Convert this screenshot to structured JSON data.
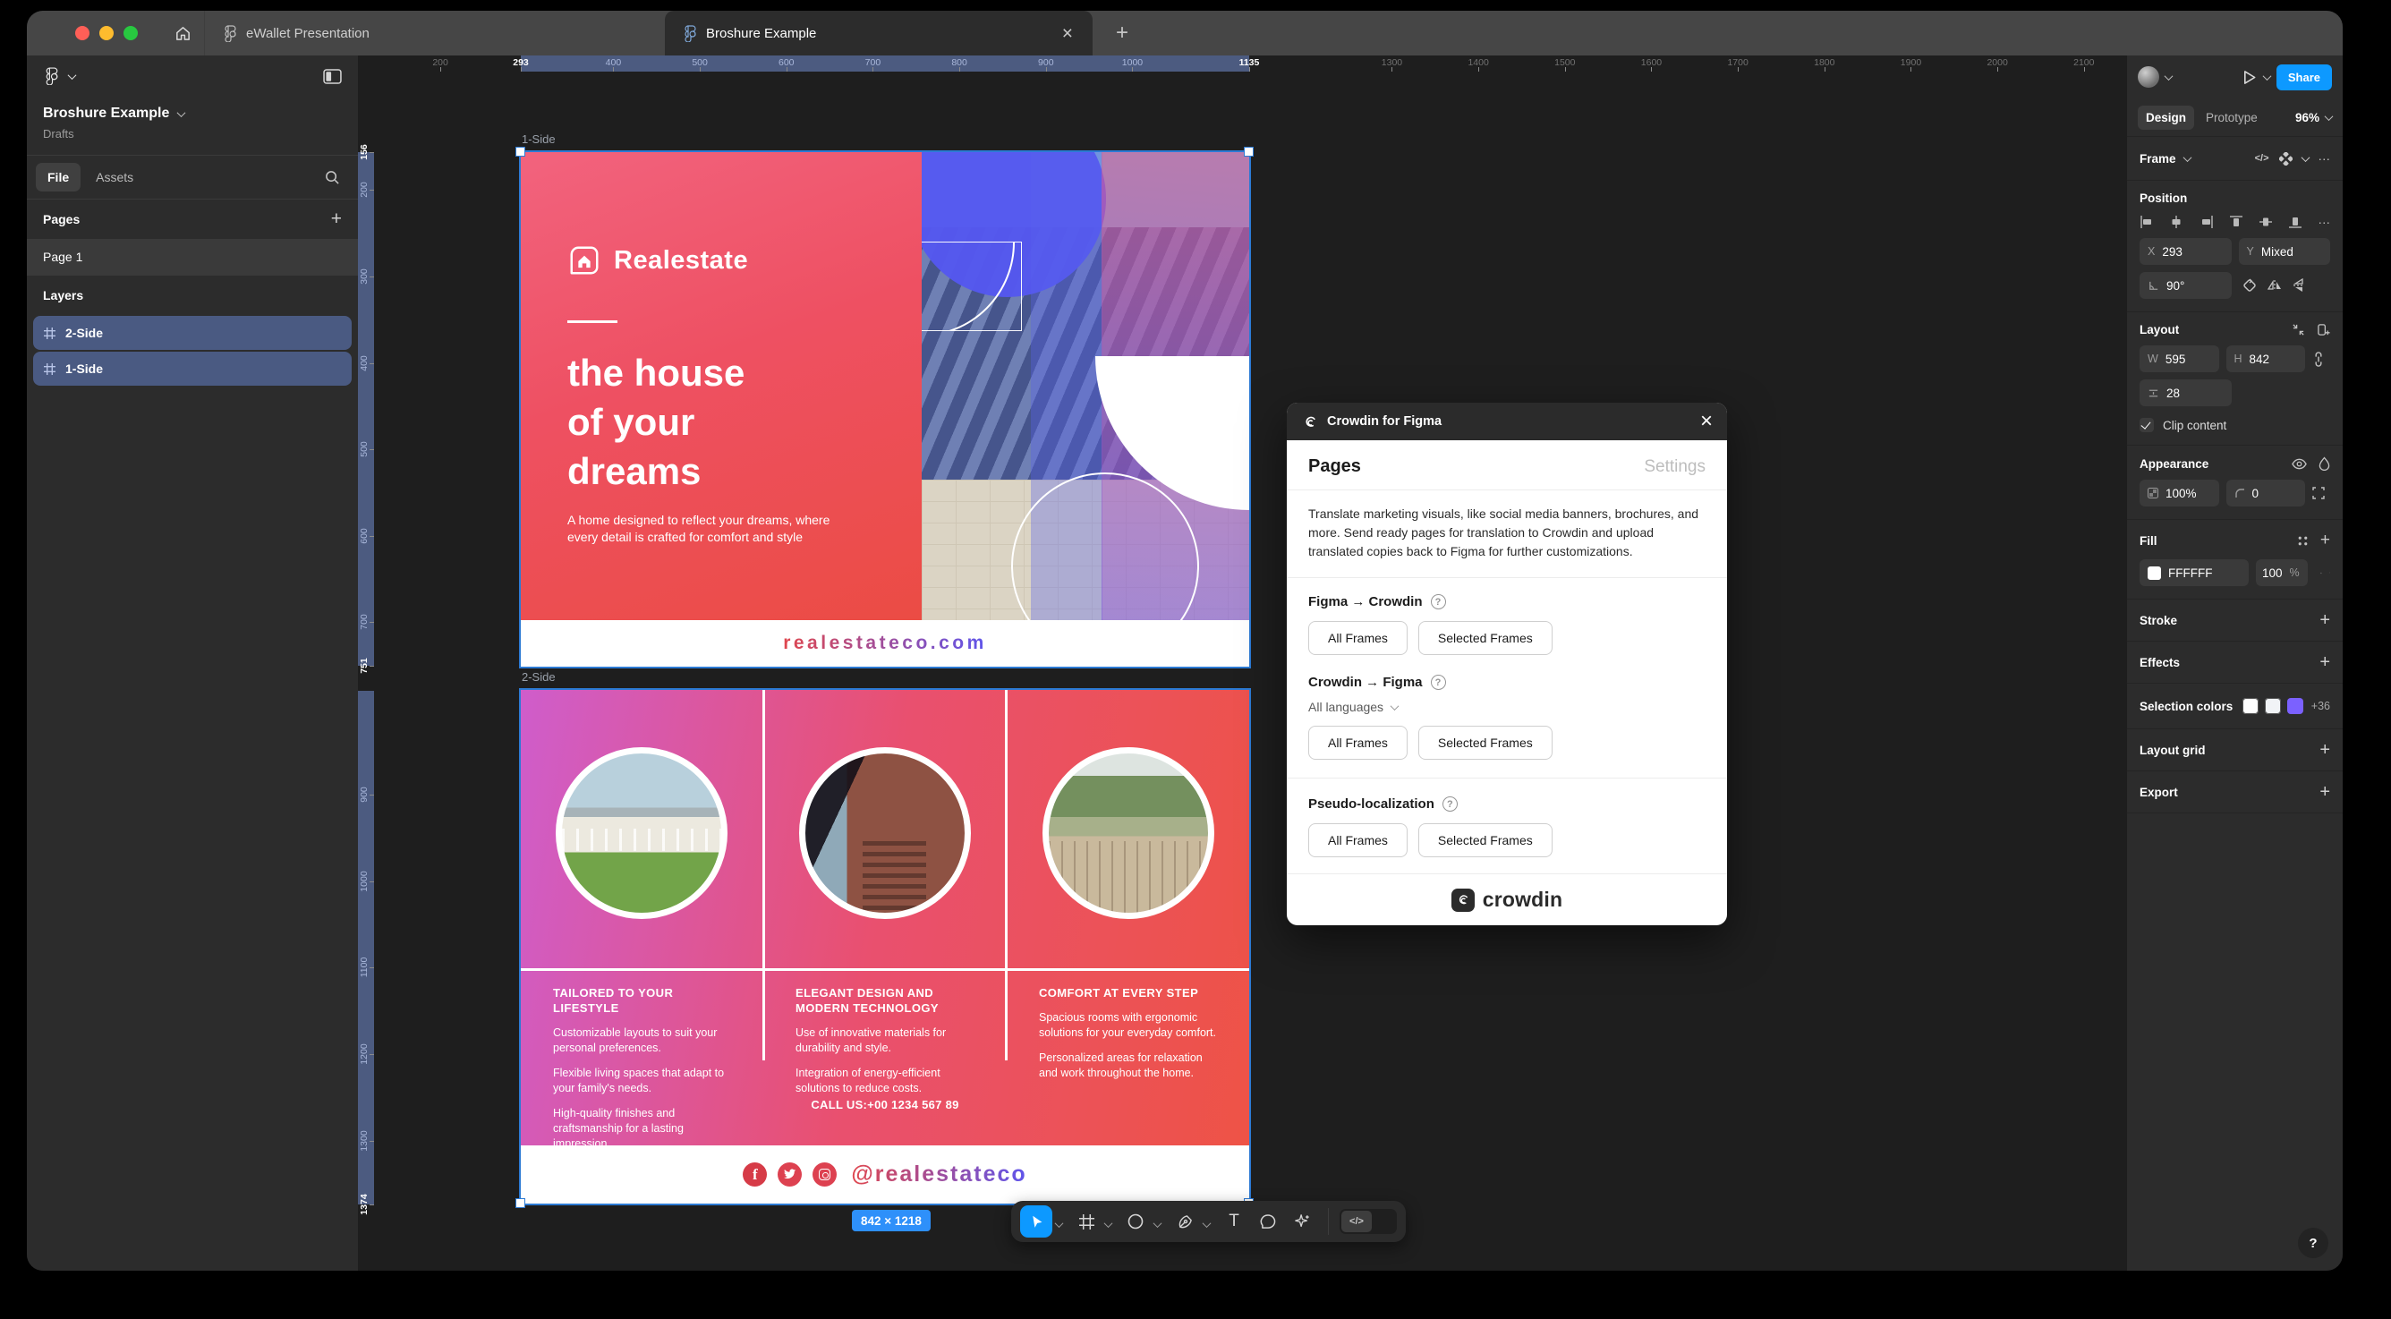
{
  "colors": {
    "accent_blue": "#0d99ff",
    "selection_blue": "#2c7ad4",
    "panel_bg": "#2c2c2c",
    "canvas_bg": "#1e1e1e",
    "traffic": [
      "#ff5f57",
      "#febc2e",
      "#28c840"
    ],
    "layer_selected_bg": "#4a5a82",
    "brochure_red_gradient": [
      "#f2637e",
      "#eb4c44"
    ],
    "brochure_pink_gradient": [
      "#cf5dcb",
      "#e9506f",
      "#ee5345"
    ],
    "social_red": "#dd4150"
  },
  "tabbar": {
    "tabs": [
      {
        "label": "eWallet Presentation"
      },
      {
        "label": "Broshure Example"
      }
    ],
    "close_glyph": "×",
    "new_tab_glyph": "+"
  },
  "sidebar": {
    "file_title": "Broshure Example",
    "file_location": "Drafts",
    "tab_file": "File",
    "tab_assets": "Assets",
    "pages_label": "Pages",
    "pages": [
      {
        "name": "Page 1"
      }
    ],
    "layers_label": "Layers",
    "layers": [
      {
        "name": "2-Side"
      },
      {
        "name": "1-Side"
      }
    ],
    "plus_glyph": "+"
  },
  "canvas": {
    "frame_labels": [
      "1-Side",
      "2-Side"
    ],
    "selection_size": "842 × 1218",
    "rulers": {
      "top": [
        200,
        293,
        400,
        500,
        600,
        700,
        800,
        900,
        1000,
        1135,
        1300,
        1400,
        1500,
        1600,
        1700,
        1800,
        1900,
        2000,
        2100
      ],
      "top_highlight": [
        293,
        1135
      ],
      "top_band": [
        293,
        1135
      ],
      "left": [
        156,
        200,
        300,
        400,
        500,
        600,
        700,
        751,
        900,
        1000,
        1100,
        1200,
        1300,
        1374
      ],
      "left_highlight": [
        156,
        751,
        1374
      ],
      "left_bands": [
        [
          156,
          751
        ],
        [
          779,
          1374
        ]
      ]
    }
  },
  "brochure_side1": {
    "brand": "Realestate",
    "headline_lines": [
      "the house",
      "of your",
      "dreams"
    ],
    "body": "A home designed to reflect your dreams, where every detail is crafted for comfort and style",
    "website": "realestateco.com"
  },
  "brochure_side2": {
    "columns": [
      {
        "heading": "TAILORED TO YOUR LIFESTYLE",
        "paragraphs": [
          "Customizable layouts to suit your personal preferences.",
          "Flexible living spaces that adapt to your family's needs.",
          "High-quality finishes and craftsmanship for a lasting impression."
        ]
      },
      {
        "heading": "ELEGANT DESIGN AND MODERN TECHNOLOGY",
        "paragraphs": [
          "Use of innovative materials for durability and style.",
          "Integration of energy-efficient solutions to reduce costs."
        ]
      },
      {
        "heading": "COMFORT AT EVERY STEP",
        "paragraphs": [
          "Spacious rooms with ergonomic solutions for your everyday comfort.",
          "Personalized areas for relaxation and work throughout the home."
        ]
      }
    ],
    "call_us": "CALL US:+00 1234 567 89",
    "social_handle": "@realestateco"
  },
  "modal": {
    "title": "Crowdin for Figma",
    "close_glyph": "×",
    "tab_pages": "Pages",
    "tab_settings": "Settings",
    "description": "Translate marketing visuals, like social media banners, brochures, and more. Send ready pages for translation to Crowdin and upload translated copies back to Figma for further customizations.",
    "help_glyph": "?",
    "sections": [
      {
        "title": "Figma → Crowdin",
        "buttons": [
          "All Frames",
          "Selected Frames"
        ]
      },
      {
        "title": "Crowdin → Figma",
        "dropdown": "All languages",
        "buttons": [
          "All Frames",
          "Selected Frames"
        ]
      },
      {
        "title": "Pseudo-localization",
        "buttons": [
          "All Frames",
          "Selected Frames"
        ]
      }
    ],
    "footer_brand": "crowdin"
  },
  "toolbar": {
    "dev_toggle_glyph": "</>"
  },
  "panel": {
    "share": "Share",
    "design_tab": "Design",
    "prototype_tab": "Prototype",
    "zoom": "96%",
    "frame_label": "Frame",
    "overflow_glyph": "···",
    "code_glyph": "</>",
    "position": {
      "title": "Position",
      "x_label": "X",
      "x_value": "293",
      "y_label": "Y",
      "y_value": "Mixed",
      "rotation": "90°"
    },
    "layout": {
      "title": "Layout",
      "w_label": "W",
      "w_value": "595",
      "h_label": "H",
      "h_value": "842",
      "gap_value": "28",
      "clip_label": "Clip content"
    },
    "appearance": {
      "title": "Appearance",
      "opacity": "100%",
      "corner_radius": "0"
    },
    "fill": {
      "title": "Fill",
      "hex": "FFFFFF",
      "opacity_value": "100",
      "unit": "%"
    },
    "stroke": {
      "title": "Stroke"
    },
    "effects": {
      "title": "Effects"
    },
    "selection_colors": {
      "title": "Selection colors",
      "overflow_count": "+36",
      "swatches": [
        "#FFFFFF",
        "#F1F3F6",
        "#7B61FF"
      ]
    },
    "layout_grid": {
      "title": "Layout grid"
    },
    "export": {
      "title": "Export"
    },
    "help_glyph": "?",
    "plus_glyph": "+"
  }
}
